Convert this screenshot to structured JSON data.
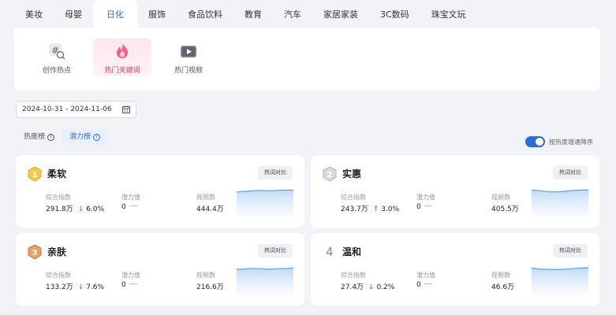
{
  "categories": [
    "美妆",
    "母婴",
    "日化",
    "服饰",
    "食品饮料",
    "教育",
    "汽车",
    "家居家装",
    "3C数码",
    "珠宝文玩"
  ],
  "active_category_index": 2,
  "subtabs": [
    {
      "label": "创作热点",
      "icon": "hashtag-search-icon"
    },
    {
      "label": "热门关键词",
      "icon": "flame-icon"
    },
    {
      "label": "热门视频",
      "icon": "play-video-icon"
    }
  ],
  "active_subtab_index": 1,
  "date_range": "2024-10-31 - 2024-11-06",
  "rank_tabs": [
    "热度榜",
    "潜力榜"
  ],
  "active_rank_tab_index": 1,
  "sort_toggle": {
    "label": "按热度增速降序",
    "on": true
  },
  "metric_labels": {
    "composite": "综合指数",
    "potential": "潜力值",
    "video": "视频数"
  },
  "compare_label": "热词对比",
  "colors": {
    "accent": "#2d6bd8",
    "hot": "#e6336a",
    "up": "#e8434a",
    "down": "#2faa5a",
    "spark_line": "#5aa0ea"
  },
  "keywords": [
    {
      "rank": "1",
      "rank_style": "gold-medal-icon",
      "name": "柔软",
      "composite": "291.8万",
      "trend_dir": "down",
      "trend_arrow": "↓",
      "trend": "6.0%",
      "potential": "0",
      "video": "444.4万",
      "spark": [
        0.78,
        0.8,
        0.82,
        0.83,
        0.82,
        0.83,
        0.84,
        0.84
      ]
    },
    {
      "rank": "2",
      "rank_style": "silver-medal-icon",
      "name": "实惠",
      "composite": "243.7万",
      "trend_dir": "up",
      "trend_arrow": "↑",
      "trend": "3.0%",
      "potential": "0",
      "video": "405.5万",
      "spark": [
        0.84,
        0.82,
        0.79,
        0.78,
        0.8,
        0.83,
        0.84,
        0.85
      ]
    },
    {
      "rank": "3",
      "rank_style": "bronze-medal-icon",
      "name": "亲肤",
      "composite": "133.2万",
      "trend_dir": "down",
      "trend_arrow": "↓",
      "trend": "7.6%",
      "potential": "0",
      "video": "216.6万",
      "spark": [
        0.8,
        0.81,
        0.83,
        0.82,
        0.8,
        0.82,
        0.83,
        0.84
      ]
    },
    {
      "rank": "4",
      "rank_style": "plain",
      "name": "温和",
      "composite": "27.4万",
      "trend_dir": "down",
      "trend_arrow": "↓",
      "trend": "0.2%",
      "potential": "0",
      "video": "46.6万",
      "spark": [
        0.84,
        0.81,
        0.8,
        0.79,
        0.8,
        0.82,
        0.84,
        0.85
      ]
    }
  ]
}
